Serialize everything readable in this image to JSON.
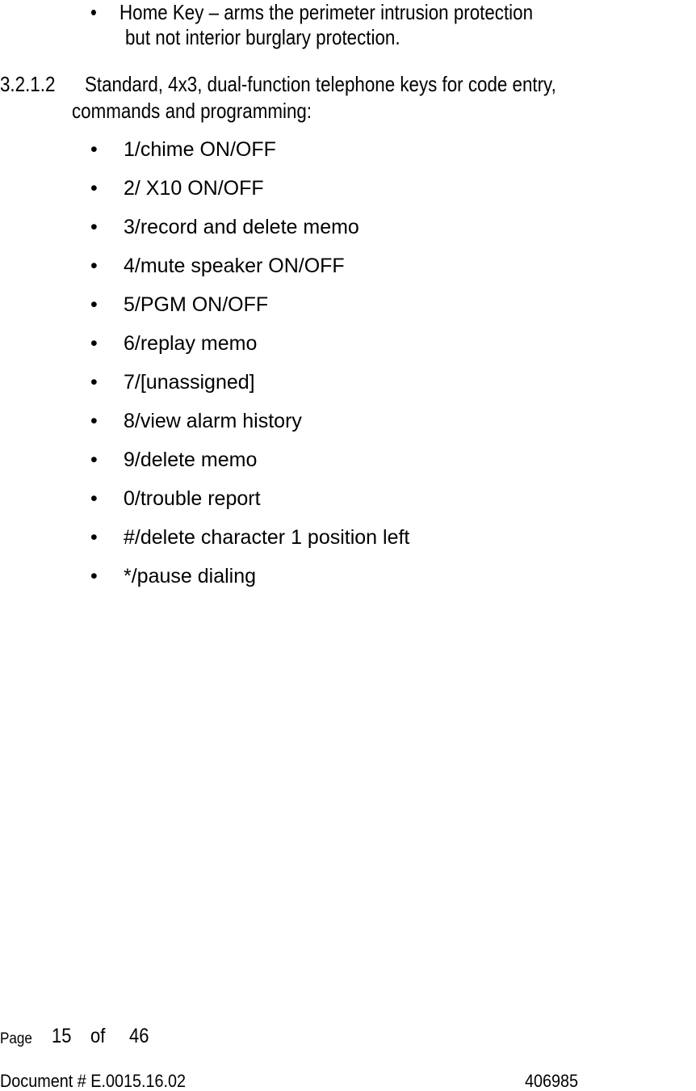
{
  "intro_bullet": {
    "bullet": "•",
    "line1": "Home Key – arms the perimeter intrusion protection",
    "line2": "but not interior burglary protection."
  },
  "section": {
    "number": "3.2.1.2",
    "title_line1": "Standard, 4x3, dual-function telephone keys for code entry,",
    "title_line2": "commands and programming:"
  },
  "key_list": {
    "bullet": "•",
    "items": [
      "1/chime ON/OFF",
      "2/ X10 ON/OFF",
      "3/record and delete memo",
      "4/mute speaker ON/OFF",
      "5/PGM ON/OFF",
      "6/replay memo",
      "7/[unassigned]",
      "8/view alarm history",
      "9/delete memo",
      "0/trouble report",
      "#/delete character 1 position left",
      "*/pause dialing"
    ]
  },
  "footer": {
    "page_label": "Page",
    "page_number": "15",
    "of_label": "of",
    "total_pages": "46",
    "document_label": "Document # E.0015.16.02",
    "document_code": "406985"
  }
}
